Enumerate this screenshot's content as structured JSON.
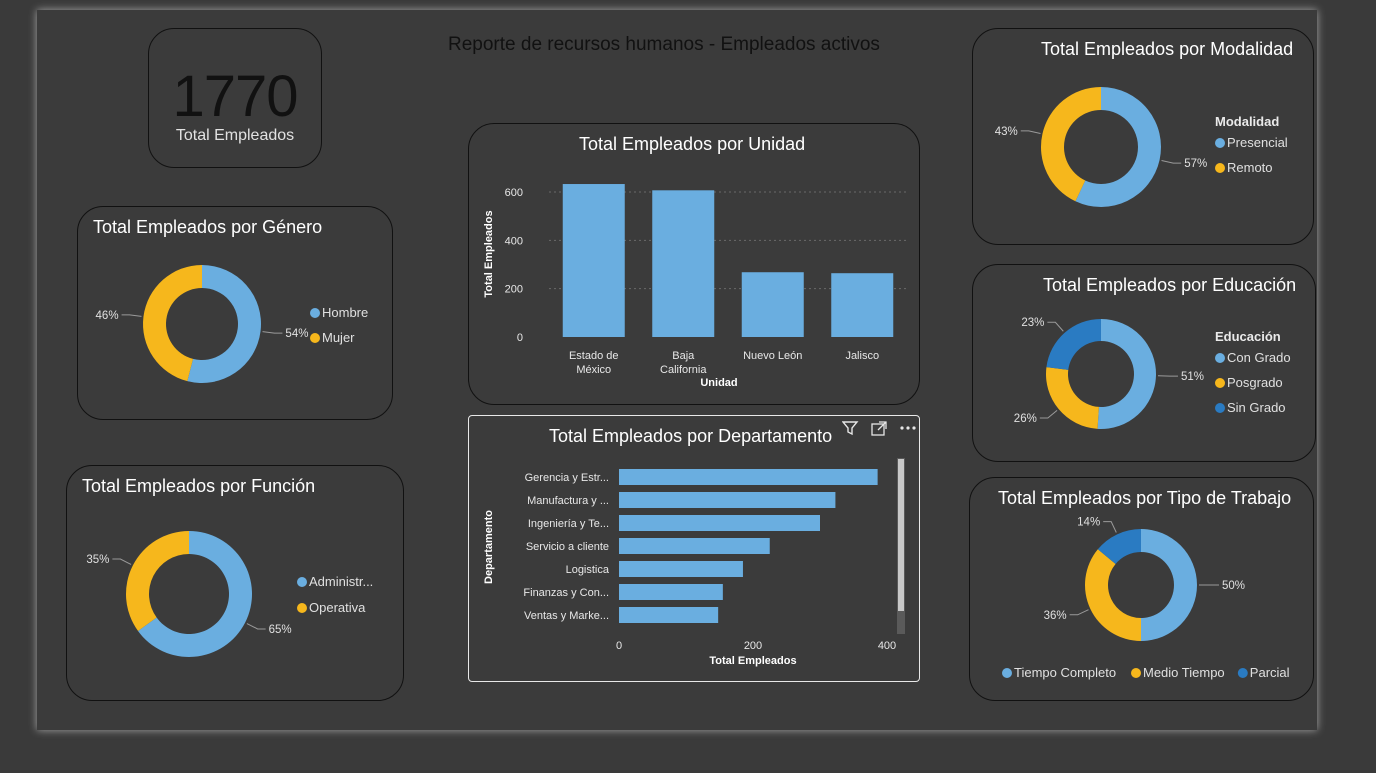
{
  "report_title": "Reporte de recursos humanos - Empleados activos",
  "kpi": {
    "value": "1770",
    "label": "Total Empleados"
  },
  "colors": {
    "light_blue": "#6aaee0",
    "yellow": "#f6b71c",
    "dark_blue": "#2a7bc2"
  },
  "genero": {
    "title": "Total Empleados por Género",
    "legend": [
      "Hombre",
      "Mujer"
    ],
    "slices": [
      {
        "label": "Hombre",
        "pct": 54,
        "text": "54%"
      },
      {
        "label": "Mujer",
        "pct": 46,
        "text": "46%"
      }
    ]
  },
  "funcion": {
    "title": "Total Empleados por Función",
    "legend": [
      "Administr...",
      "Operativa"
    ],
    "slices": [
      {
        "label": "Administr...",
        "pct": 65,
        "text": "65%"
      },
      {
        "label": "Operativa",
        "pct": 35,
        "text": "35%"
      }
    ]
  },
  "modalidad": {
    "title": "Total Empleados por Modalidad",
    "legend_title": "Modalidad",
    "legend": [
      "Presencial",
      "Remoto"
    ],
    "slices": [
      {
        "label": "Presencial",
        "pct": 57,
        "text": "57%"
      },
      {
        "label": "Remoto",
        "pct": 43,
        "text": "43%"
      }
    ]
  },
  "educacion": {
    "title": "Total Empleados por Educación",
    "legend_title": "Educación",
    "legend": [
      "Con Grado",
      "Posgrado",
      "Sin Grado"
    ],
    "slices": [
      {
        "label": "Con Grado",
        "pct": 51,
        "text": "51%"
      },
      {
        "label": "Posgrado",
        "pct": 26,
        "text": "26%"
      },
      {
        "label": "Sin Grado",
        "pct": 23,
        "text": "23%"
      }
    ]
  },
  "tipo_trabajo": {
    "title": "Total Empleados por Tipo de Trabajo",
    "legend": [
      "Tiempo Completo",
      "Medio Tiempo",
      "Parcial"
    ],
    "slices": [
      {
        "label": "Tiempo Completo",
        "pct": 50,
        "text": "50%"
      },
      {
        "label": "Medio Tiempo",
        "pct": 36,
        "text": "36%"
      },
      {
        "label": "Parcial",
        "pct": 14,
        "text": "14%"
      }
    ]
  },
  "unidad": {
    "title": "Total Empleados por Unidad",
    "xlabel": "Unidad",
    "ylabel": "Total Empleados",
    "categories": [
      [
        "Estado de",
        "México"
      ],
      [
        "Baja",
        "California"
      ],
      [
        "Nuevo León"
      ],
      [
        "Jalisco"
      ]
    ],
    "ticks": [
      "0",
      "200",
      "400",
      "600"
    ]
  },
  "departamento": {
    "title": "Total Empleados por Departamento",
    "xlabel": "Total Empleados",
    "ylabel": "Departamento",
    "categories": [
      "Gerencia y Estr...",
      "Manufactura y ...",
      "Ingeniería y Te...",
      "Servicio a cliente",
      "Logistica",
      "Finanzas y Con...",
      "Ventas y Marke..."
    ],
    "ticks": [
      "0",
      "200",
      "400"
    ]
  },
  "chart_data": [
    {
      "type": "bar",
      "title": "Total Empleados por Unidad",
      "xlabel": "Unidad",
      "ylabel": "Total Empleados",
      "categories": [
        "Estado de México",
        "Baja California",
        "Nuevo León",
        "Jalisco"
      ],
      "values": [
        633,
        607,
        268,
        264
      ],
      "ylim": [
        0,
        600
      ]
    },
    {
      "type": "bar",
      "orientation": "horizontal",
      "title": "Total Empleados por Departamento",
      "xlabel": "Total Empleados",
      "ylabel": "Departamento",
      "categories": [
        "Gerencia y Estr...",
        "Manufactura y ...",
        "Ingeniería y Te...",
        "Servicio a cliente",
        "Logistica",
        "Finanzas y Con...",
        "Ventas y Marke..."
      ],
      "values": [
        386,
        323,
        300,
        225,
        185,
        155,
        148
      ],
      "xlim": [
        0,
        400
      ]
    },
    {
      "type": "pie",
      "title": "Total Empleados por Género",
      "categories": [
        "Hombre",
        "Mujer"
      ],
      "values": [
        54,
        46
      ]
    },
    {
      "type": "pie",
      "title": "Total Empleados por Función",
      "categories": [
        "Administr...",
        "Operativa"
      ],
      "values": [
        65,
        35
      ]
    },
    {
      "type": "pie",
      "title": "Total Empleados por Modalidad",
      "categories": [
        "Presencial",
        "Remoto"
      ],
      "values": [
        57,
        43
      ]
    },
    {
      "type": "pie",
      "title": "Total Empleados por Educación",
      "categories": [
        "Con Grado",
        "Posgrado",
        "Sin Grado"
      ],
      "values": [
        51,
        26,
        23
      ]
    },
    {
      "type": "pie",
      "title": "Total Empleados por Tipo de Trabajo",
      "categories": [
        "Tiempo Completo",
        "Medio Tiempo",
        "Parcial"
      ],
      "values": [
        50,
        36,
        14
      ]
    }
  ]
}
